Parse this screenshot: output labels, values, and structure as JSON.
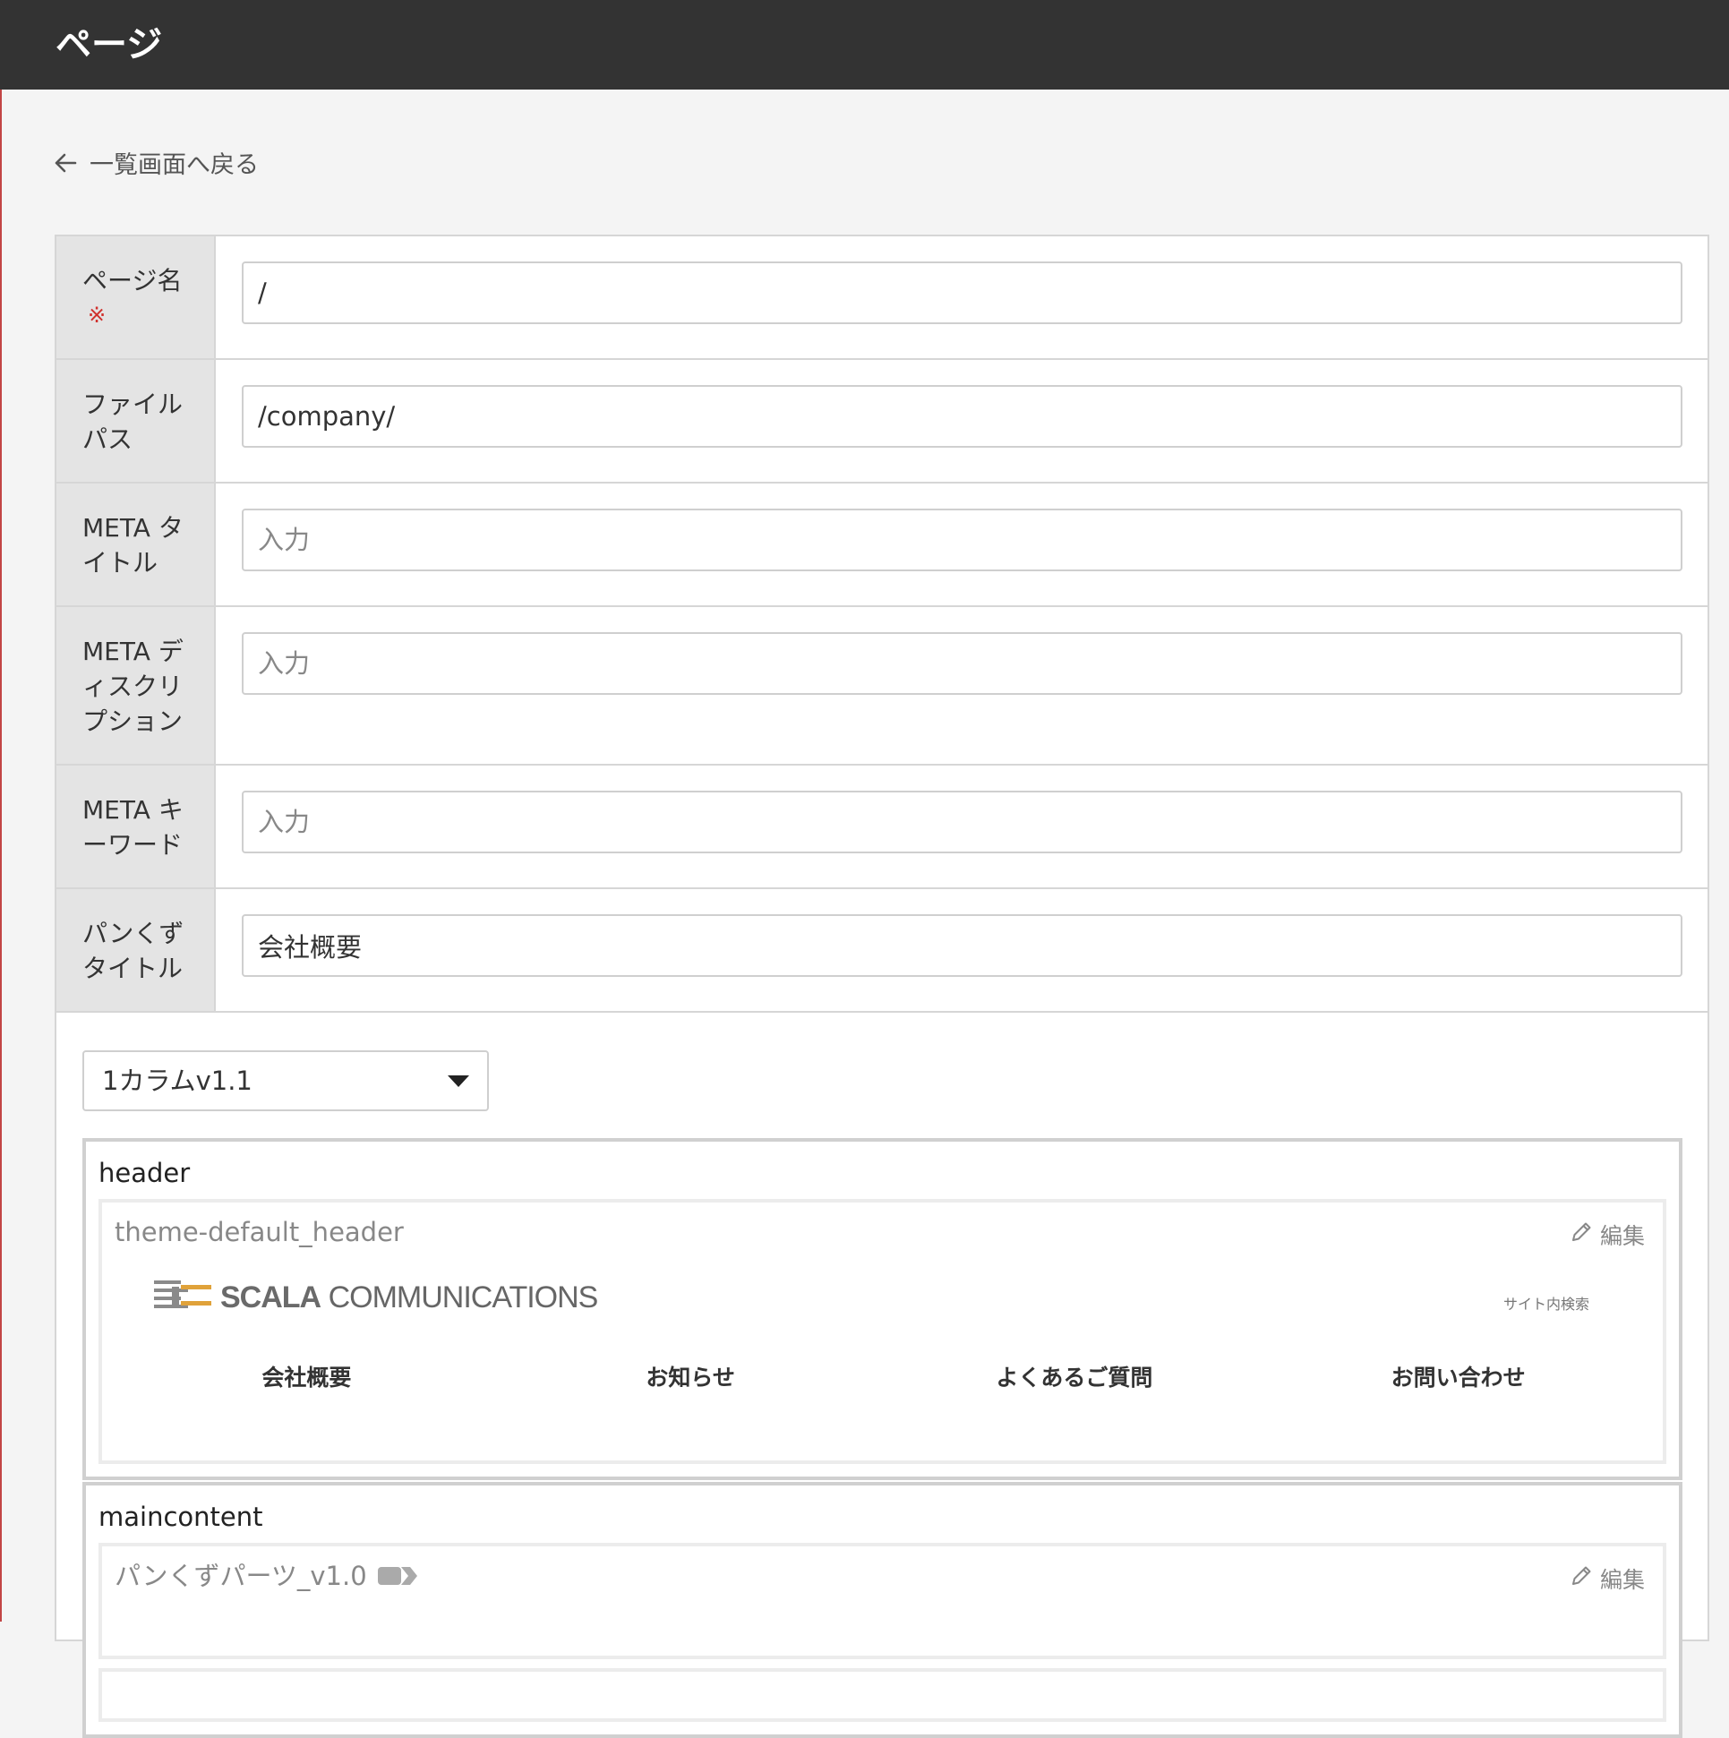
{
  "header": {
    "title": "ページ"
  },
  "back_link": {
    "label": "一覧画面へ戻る"
  },
  "form": {
    "page_name": {
      "label": "ページ名",
      "required_mark": "※",
      "value": "/"
    },
    "file_path": {
      "label_line1": "ファイル",
      "label_line2": "パス",
      "value": "/company/"
    },
    "meta_title": {
      "label_line1": "META タ",
      "label_line2": "イトル",
      "placeholder": "入力"
    },
    "meta_description": {
      "label_line1": "META デ",
      "label_line2": "ィスクリ",
      "label_line3": "プション",
      "placeholder": "入力"
    },
    "meta_keywords": {
      "label_line1": "META キ",
      "label_line2": "ーワード",
      "placeholder": "入力"
    },
    "breadcrumb_title": {
      "label_line1": "パンくず",
      "label_line2": "タイトル",
      "value": "会社概要"
    }
  },
  "layout": {
    "selected_template": "1カラムv1.1",
    "regions": [
      {
        "name": "header",
        "part": {
          "title": "theme-default_header",
          "edit_label": "編集",
          "logo_bold": "SCALA",
          "logo_rest": "COMMUNICATIONS",
          "site_search": "サイト内検索",
          "nav": [
            "会社概要",
            "お知らせ",
            "よくあるご質問",
            "お問い合わせ"
          ]
        }
      },
      {
        "name": "maincontent",
        "part": {
          "title": "パンくずパーツ_v1.0",
          "edit_label": "編集"
        }
      }
    ]
  },
  "colors": {
    "topbar": "#333333",
    "required": "#d0312d",
    "logo_orange": "#e0a23a",
    "logo_gray": "#8a8a8a"
  }
}
